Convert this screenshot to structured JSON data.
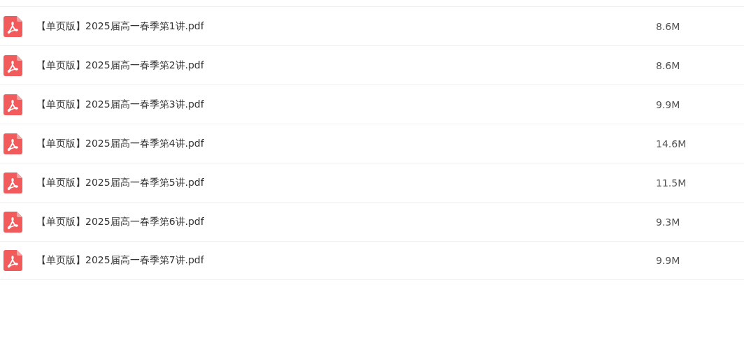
{
  "files": [
    {
      "name": "【单页版】2025届高一春季第1讲.pdf",
      "size": "8.6M"
    },
    {
      "name": "【单页版】2025届高一春季第2讲.pdf",
      "size": "8.6M"
    },
    {
      "name": "【单页版】2025届高一春季第3讲.pdf",
      "size": "9.9M"
    },
    {
      "name": "【单页版】2025届高一春季第4讲.pdf",
      "size": "14.6M"
    },
    {
      "name": "【单页版】2025届高一春季第5讲.pdf",
      "size": "11.5M"
    },
    {
      "name": "【单页版】2025届高一春季第6讲.pdf",
      "size": "9.3M"
    },
    {
      "name": "【单页版】2025届高一春季第7讲.pdf",
      "size": "9.9M"
    }
  ]
}
